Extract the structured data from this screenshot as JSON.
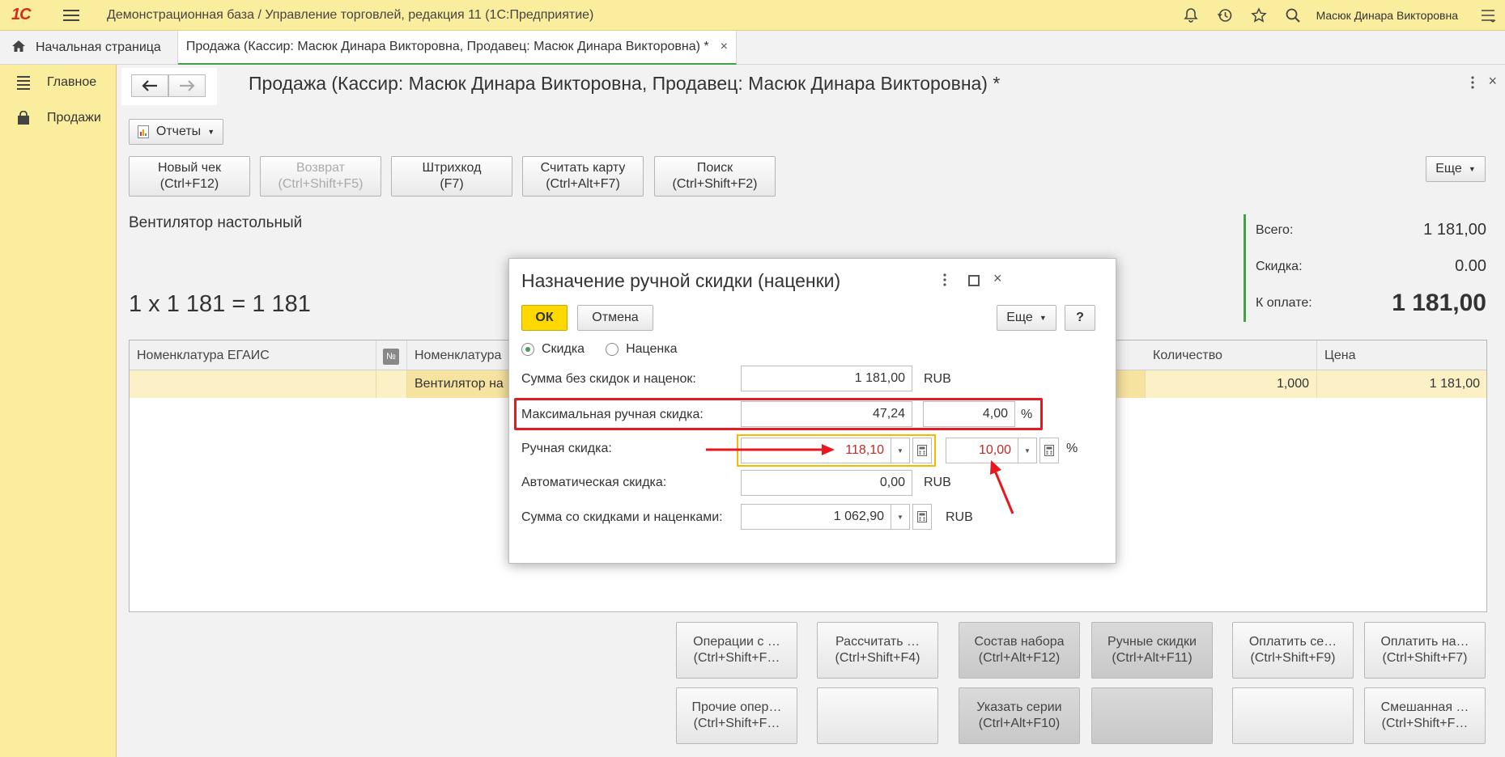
{
  "topbar": {
    "logo": "1С",
    "title": "Демонстрационная база / Управление торговлей, редакция 11   (1С:Предприятие)",
    "user": "Масюк Динара Викторовна",
    "icons": [
      "bell-icon",
      "history-icon",
      "star-icon",
      "search-icon",
      "menu-lines-icon"
    ]
  },
  "tabs": {
    "home": "Начальная страница",
    "active": "Продажа (Кассир: Масюк Динара Викторовна, Продавец: Масюк Динара Викторовна) *",
    "close": "×"
  },
  "sidebar": {
    "items": [
      {
        "label": "Главное",
        "icon": "list-icon"
      },
      {
        "label": "Продажи",
        "icon": "bag-icon"
      }
    ]
  },
  "form": {
    "back": "🡐",
    "forward": "🡒",
    "title": "Продажа (Кассир: Масюк Динара Викторовна, Продавец: Масюк Динара Викторовна) *",
    "reports": "Отчеты",
    "more": "Еще",
    "close": "×",
    "actions": [
      {
        "line1": "Новый чек",
        "line2": "(Ctrl+F12)",
        "disabled": false
      },
      {
        "line1": "Возврат",
        "line2": "(Ctrl+Shift+F5)",
        "disabled": true
      },
      {
        "line1": "Штрихкод",
        "line2": "(F7)",
        "disabled": false
      },
      {
        "line1": "Считать карту",
        "line2": "(Ctrl+Alt+F7)",
        "disabled": false
      },
      {
        "line1": "Поиск",
        "line2": "(Ctrl+Shift+F2)",
        "disabled": false
      }
    ],
    "product_name": "Вентилятор настольный",
    "formula": "1 x 1 181 = 1 181"
  },
  "totals": {
    "total_label": "Всего:",
    "total_value": "1 181,00",
    "discount_label": "Скидка:",
    "discount_value": "0.00",
    "pay_label": "К оплате:",
    "pay_value": "1 181,00"
  },
  "grid": {
    "headers": [
      "Номенклатура ЕГАИС",
      "№",
      "Номенклатура",
      "Количество",
      "Цена"
    ],
    "row": {
      "egais": "",
      "nomenclature": "Вентилятор на",
      "quantity": "1,000",
      "price": "1 181,00"
    }
  },
  "panel_buttons": [
    {
      "line1": "Операции с …",
      "line2": "(Ctrl+Shift+F…",
      "dark": false
    },
    {
      "line1": "Рассчитать …",
      "line2": "(Ctrl+Shift+F4)",
      "dark": false
    },
    {
      "line1": "Состав набора",
      "line2": "(Ctrl+Alt+F12)",
      "dark": true
    },
    {
      "line1": "Ручные скидки",
      "line2": "(Ctrl+Alt+F11)",
      "dark": true
    },
    {
      "line1": "Оплатить се…",
      "line2": "(Ctrl+Shift+F9)",
      "dark": false
    },
    {
      "line1": "Оплатить на…",
      "line2": "(Ctrl+Shift+F7)",
      "dark": false
    },
    {
      "line1": "Прочие опер…",
      "line2": "(Ctrl+Shift+F…",
      "dark": false
    },
    {
      "line1": "",
      "line2": "",
      "dark": false
    },
    {
      "line1": "Указать серии",
      "line2": "(Ctrl+Alt+F10)",
      "dark": true
    },
    {
      "line1": "",
      "line2": "",
      "dark": true
    },
    {
      "line1": "",
      "line2": "",
      "dark": false
    },
    {
      "line1": "Смешанная …",
      "line2": "(Ctrl+Shift+F…",
      "dark": false
    }
  ],
  "modal": {
    "title": "Назначение ручной скидки (наценки)",
    "ok": "ОК",
    "cancel": "Отмена",
    "more": "Еще",
    "help": "?",
    "close": "×",
    "radio_discount": "Скидка",
    "radio_markup": "Наценка",
    "selected": "discount",
    "sum_label": "Сумма без скидок и наценок:",
    "sum_value": "1 181,00",
    "sum_unit": "RUB",
    "max_label": "Максимальная ручная скидка:",
    "max_value": "47,24",
    "max_percent": "4,00",
    "max_unit": "%",
    "manual_label": "Ручная скидка:",
    "manual_value": "118,10",
    "manual_percent": "10,00",
    "manual_unit": "%",
    "auto_label": "Автоматическая скидка:",
    "auto_value": "0,00",
    "auto_unit": "RUB",
    "final_label": "Сумма со скидками и наценками:",
    "final_value": "1 062,90",
    "final_unit": "RUB",
    "accent_red": "#e5191f",
    "accent_yellow": "#f6b800"
  }
}
